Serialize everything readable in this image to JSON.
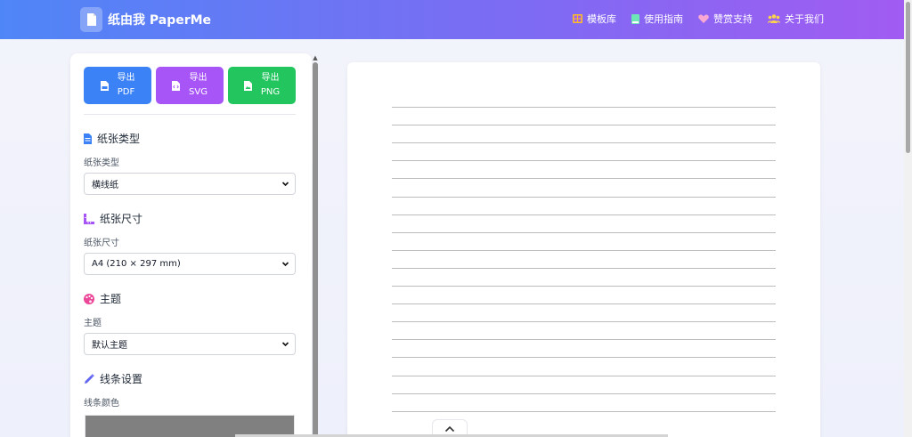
{
  "header": {
    "brand": "纸由我 PaperMe",
    "nav": [
      {
        "label": "模板库",
        "icon": "grid-icon",
        "color": "#fbbf24"
      },
      {
        "label": "使用指南",
        "icon": "book-icon",
        "color": "#6ee7b7"
      },
      {
        "label": "赞赏支持",
        "icon": "heart-icon",
        "color": "#f9a8d4"
      },
      {
        "label": "关于我们",
        "icon": "users-icon",
        "color": "#fcd34d"
      }
    ]
  },
  "export": {
    "pdf": {
      "line1": "导出",
      "line2": "PDF",
      "color": "#3b82f6"
    },
    "svg": {
      "line1": "导出",
      "line2": "SVG",
      "color": "#a855f7"
    },
    "png": {
      "line1": "导出",
      "line2": "PNG",
      "color": "#22c55e"
    }
  },
  "sections": {
    "paper_type": {
      "title": "纸张类型",
      "label": "纸张类型",
      "value": "横线纸"
    },
    "paper_size": {
      "title": "纸张尺寸",
      "label": "纸张尺寸",
      "value": "A4 (210 × 297 mm)"
    },
    "theme": {
      "title": "主题",
      "label": "主题",
      "value": "默认主题"
    },
    "line_settings": {
      "title": "线条设置",
      "label": "线条颜色",
      "color_value": "#808080"
    }
  },
  "preview": {
    "line_color": "#bdbdbd",
    "line_count": 18
  }
}
